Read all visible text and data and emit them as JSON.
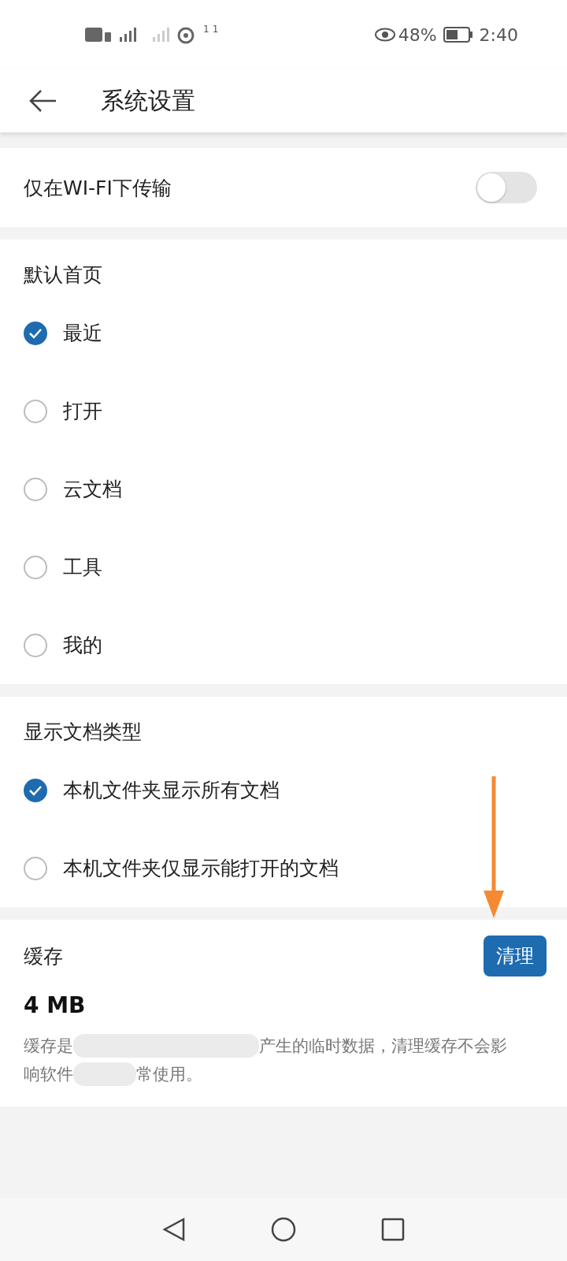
{
  "status_bar": {
    "battery_percent": "48%",
    "time": "2:40",
    "sim_badge": "1",
    "hotspot_badge": "1"
  },
  "header": {
    "title": "系统设置"
  },
  "wifi_only": {
    "label": "仅在WI-FI下传输",
    "on": false
  },
  "sections": [
    {
      "title": "默认首页",
      "options": [
        {
          "label": "最近",
          "selected": true
        },
        {
          "label": "打开",
          "selected": false
        },
        {
          "label": "云文档",
          "selected": false
        },
        {
          "label": "工具",
          "selected": false
        },
        {
          "label": "我的",
          "selected": false
        }
      ]
    },
    {
      "title": "显示文档类型",
      "options": [
        {
          "label": "本机文件夹显示所有文档",
          "selected": true
        },
        {
          "label": "本机文件夹仅显示能打开的文档",
          "selected": false
        }
      ]
    }
  ],
  "cache": {
    "title": "缓存",
    "size": "4 MB",
    "button": "清理",
    "description_lines": [
      {
        "segments": [
          "缓存是",
          "产生的临时数据，清理缓存不会影"
        ]
      },
      {
        "segments": [
          "响软件",
          "常使用。"
        ]
      }
    ]
  }
}
